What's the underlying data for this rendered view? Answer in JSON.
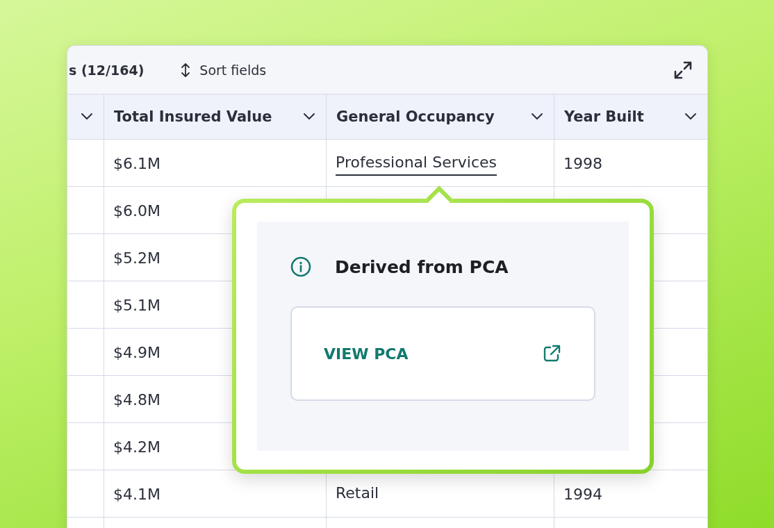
{
  "toolbar": {
    "record_count": "s (12/164)",
    "sort_button": "Sort fields"
  },
  "table": {
    "columns": [
      {},
      {
        "label": "Total Insured Value"
      },
      {
        "label": "General Occupancy"
      },
      {
        "label": "Year Built"
      }
    ],
    "rows": [
      {
        "total_insured_value": "$6.1M",
        "general_occupancy": "Professional Services",
        "general_occupancy_link": true,
        "year_built": "1998"
      },
      {
        "total_insured_value": "$6.0M"
      },
      {
        "total_insured_value": "$5.2M"
      },
      {
        "total_insured_value": "$5.1M"
      },
      {
        "total_insured_value": "$4.9M"
      },
      {
        "total_insured_value": "$4.8M"
      },
      {
        "total_insured_value": "$4.2M"
      },
      {
        "total_insured_value": "$4.1M",
        "general_occupancy": "Retail",
        "general_occupancy_link": false,
        "year_built": "1994"
      }
    ]
  },
  "popover": {
    "title": "Derived from PCA",
    "link_button": "VIEW PCA"
  }
}
